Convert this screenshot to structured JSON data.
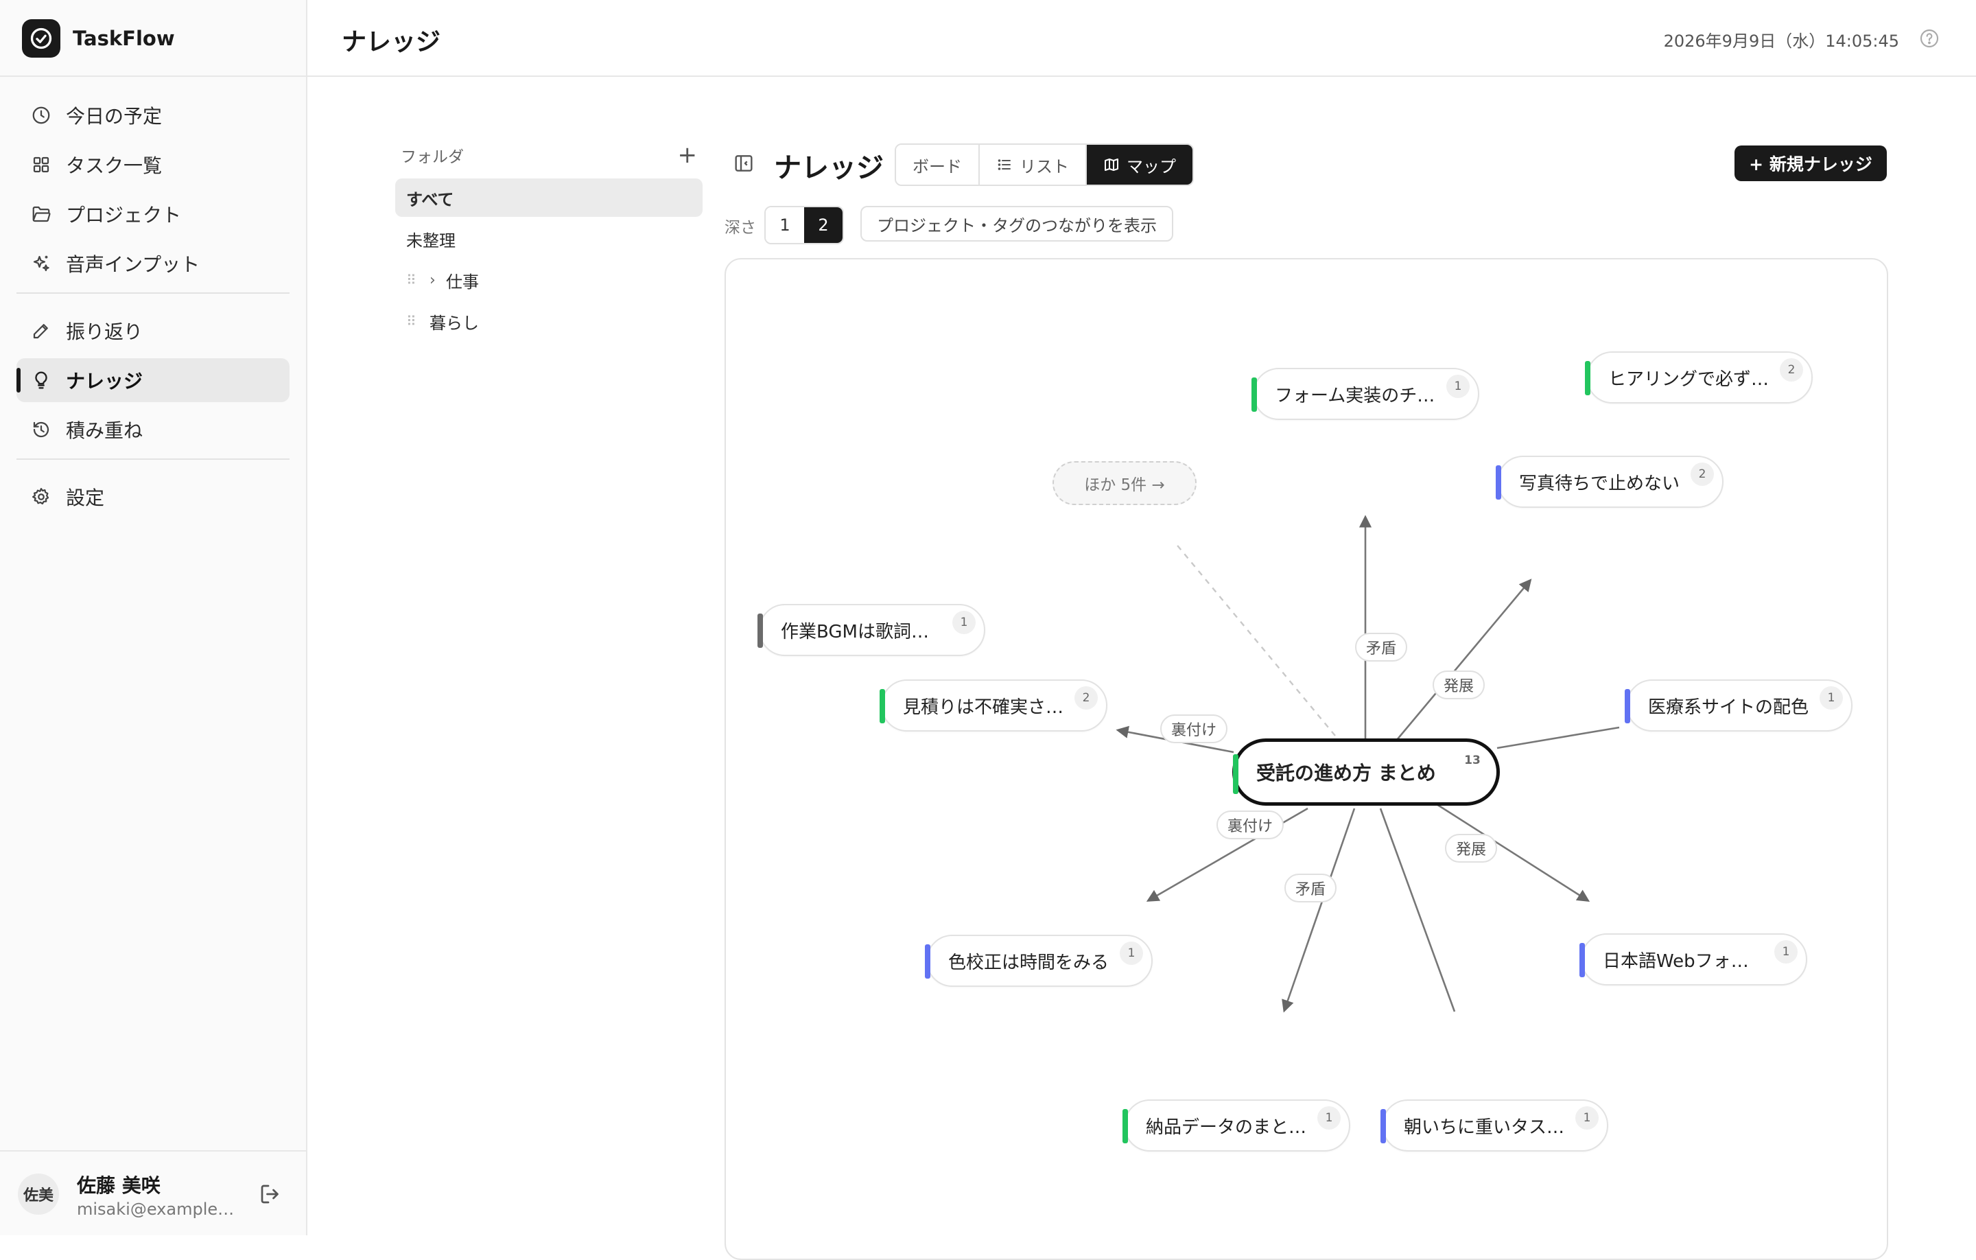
{
  "app": {
    "name": "TaskFlow"
  },
  "header": {
    "title": "ナレッジ",
    "datetime": "2026年9月9日（水）14:05:45"
  },
  "sidebar": {
    "items": [
      {
        "label": "今日の予定",
        "icon": "clock-icon"
      },
      {
        "label": "タスク一覧",
        "icon": "grid-icon"
      },
      {
        "label": "プロジェクト",
        "icon": "folder-icon"
      },
      {
        "label": "音声インプット",
        "icon": "sparkle-icon"
      },
      {
        "label": "振り返り",
        "icon": "pencil-icon"
      },
      {
        "label": "ナレッジ",
        "icon": "lightbulb-icon",
        "active": true
      },
      {
        "label": "積み重ね",
        "icon": "history-icon"
      },
      {
        "label": "設定",
        "icon": "gear-icon"
      }
    ],
    "user": {
      "avatar": "佐美",
      "name": "佐藤 美咲",
      "email": "misaki@example.com"
    }
  },
  "folders": {
    "title": "フォルダ",
    "add": "+",
    "items": [
      {
        "label": "すべて",
        "active": true
      },
      {
        "label": "未整理"
      },
      {
        "label": "仕事"
      },
      {
        "label": "暮らし"
      }
    ]
  },
  "knowledge": {
    "title": "ナレッジ",
    "views": [
      {
        "label": "ボード"
      },
      {
        "label": "リスト",
        "icon": "list-icon"
      },
      {
        "label": "マップ",
        "icon": "map-icon",
        "active": true
      }
    ],
    "new_button": "+ 新規ナレッジ",
    "depth": {
      "label": "深さ",
      "options": [
        "1",
        "2"
      ],
      "selected": "2"
    },
    "connections_button": "プロジェクト・タグのつながりを表示"
  },
  "colors": {
    "green": "#22c55e",
    "blue": "#6172f3",
    "gray": "#6b6b6b",
    "accent": "#1a1a1a"
  },
  "map": {
    "center": {
      "label": "受託の進め方 まとめ",
      "count": "13",
      "color": "green"
    },
    "nodes": [
      {
        "label": "フォーム実装のチェックリスト",
        "count": "1",
        "color": "green"
      },
      {
        "label": "ヒアリングで必ず聞くこと",
        "count": "2",
        "color": "green"
      },
      {
        "label": "写真待ちで止めない",
        "count": "2",
        "color": "blue"
      },
      {
        "label": "作業BGMは歌詞なし",
        "count": "1",
        "color": "gray"
      },
      {
        "label": "見積りは不確実さを見込む",
        "count": "2",
        "color": "green"
      },
      {
        "label": "医療系サイトの配色",
        "count": "1",
        "color": "blue"
      },
      {
        "label": "色校正は時間をみる",
        "count": "1",
        "color": "blue"
      },
      {
        "label": "日本語Webフォントの選び方",
        "count": "1",
        "color": "blue"
      },
      {
        "label": "納品データのまとめ方",
        "count": "1",
        "color": "green"
      },
      {
        "label": "朝いちに重いタスクを",
        "count": "1",
        "color": "blue"
      }
    ],
    "more": "ほか 5件 →",
    "edge_labels": [
      "矛盾",
      "発展",
      "裏付け",
      "裏付け",
      "矛盾",
      "発展"
    ]
  }
}
